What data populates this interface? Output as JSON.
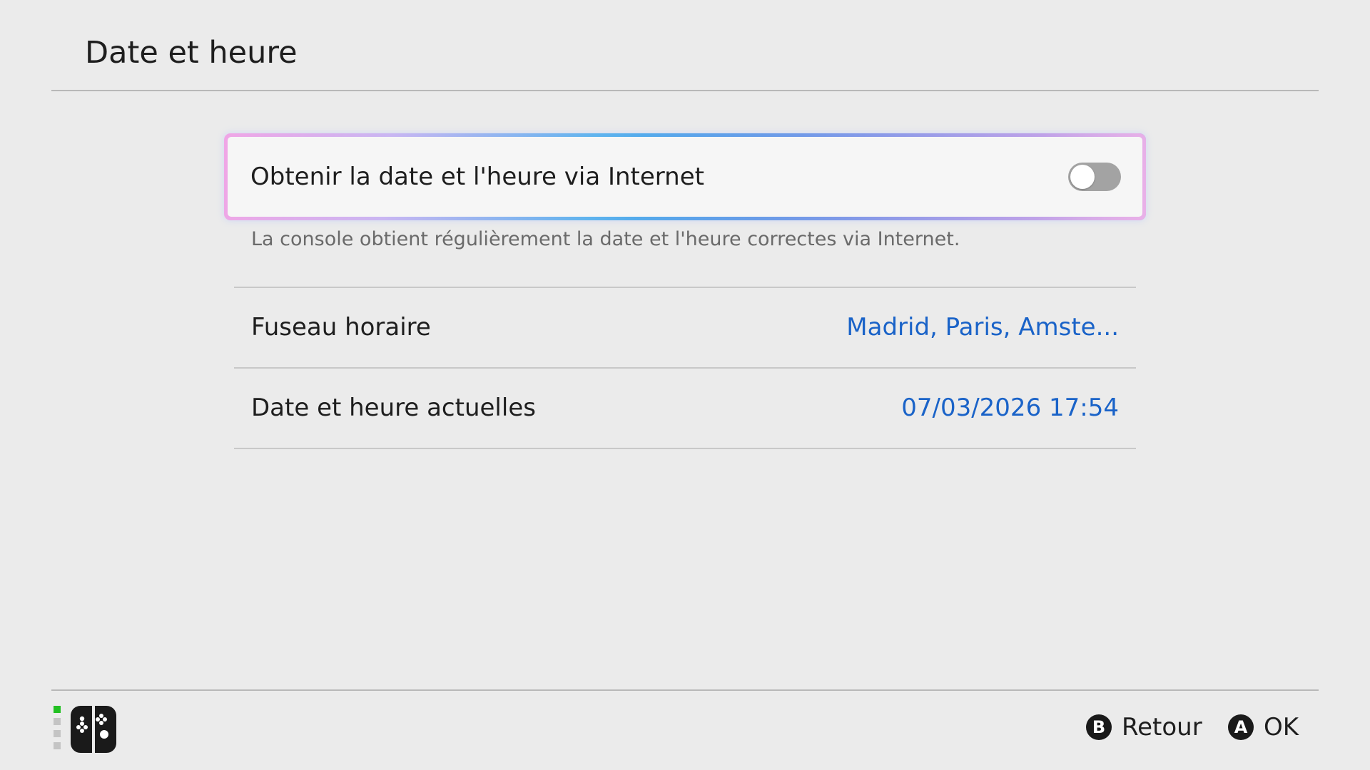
{
  "header": {
    "title": "Date et heure"
  },
  "internet_sync": {
    "label": "Obtenir la date et l'heure via Internet",
    "enabled": false,
    "description": "La console obtient régulièrement la date et l'heure correctes via Internet."
  },
  "settings": [
    {
      "label": "Fuseau horaire",
      "value": "Madrid, Paris, Amste..."
    },
    {
      "label": "Date et heure actuelles",
      "value": "07/03/2026 17:54"
    }
  ],
  "footer": {
    "actions": [
      {
        "button": "B",
        "label": "Retour"
      },
      {
        "button": "A",
        "label": "OK"
      }
    ],
    "controller_icon": "joycon-pair-icon",
    "player_indicator_color": "#22c022"
  },
  "colors": {
    "background": "#ebebeb",
    "accent_value": "#1a63c8",
    "focus_blue": "#1f7fe0",
    "focus_pink": "#f0a6e6"
  }
}
